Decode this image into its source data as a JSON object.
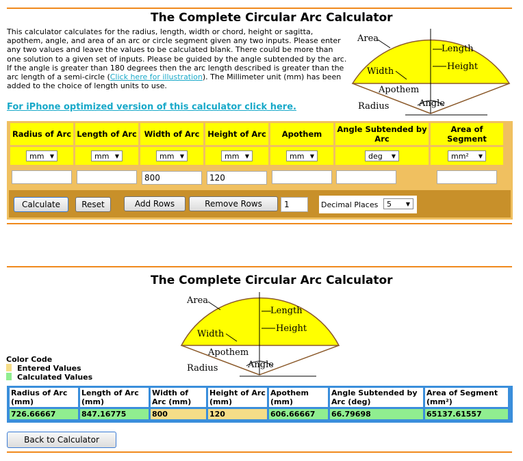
{
  "page": {
    "title": "The Complete Circular Arc Calculator",
    "description_1": "This calculator calculates for the radius, length, width or chord, height or sagitta, apothem, angle, and area of an arc or circle segment given any two inputs. Please enter any two values and leave the values to be calculated blank. There could be more than one solution to a given set of inputs. Please be guided by the angle subtended by the arc. If the angle is greater than 180 degrees then the arc length described is greater than the arc length of a semi-circle (",
    "illustration_link": "Click here for illustration",
    "description_2": "). The Millimeter unit (mm) has been added to the choice of length units to use.",
    "iphone_link": "For iPhone optimized version of this calculator click here."
  },
  "diagram": {
    "area": "Area",
    "length": "Length",
    "height": "Height",
    "width": "Width",
    "apothem": "Apothem",
    "radius": "Radius",
    "angle": "Angle",
    "fill_color": "#ffff00"
  },
  "calculator": {
    "headers": [
      "Radius of Arc",
      "Length of Arc",
      "Width of Arc",
      "Height of Arc",
      "Apothem",
      "Angle Subtended by Arc",
      "Area of Segment"
    ],
    "units": [
      "mm",
      "mm",
      "mm",
      "mm",
      "mm",
      "deg",
      "mm²"
    ],
    "values": [
      "",
      "",
      "800",
      "120",
      "",
      "",
      ""
    ],
    "calculate": "Calculate",
    "reset": "Reset",
    "add_rows": "Add Rows",
    "remove_rows": "Remove Rows",
    "rows_value": "1",
    "decimal_label": "Decimal Places",
    "decimal_value": "5"
  },
  "results": {
    "title": "The Complete Circular Arc Calculator",
    "color_code": "Color Code",
    "entered": "Entered Values",
    "calculated": "Calculated Values",
    "headers": [
      "Radius of Arc (mm)",
      "Length of Arc (mm)",
      "Width of Arc (mm)",
      "Height of Arc (mm)",
      "Apothem (mm)",
      "Angle Subtended by Arc (deg)",
      "Area of Segment (mm²)"
    ],
    "values": [
      "726.66667",
      "847.16775",
      "800",
      "120",
      "606.66667",
      "66.79698",
      "65137.61557"
    ],
    "back": "Back to Calculator"
  },
  "colors": {
    "accent": "#f0891c",
    "entered": "#f5dd88",
    "calculated": "#90ee90",
    "link": "#19a9c9",
    "table_border": "#3a8edb"
  }
}
